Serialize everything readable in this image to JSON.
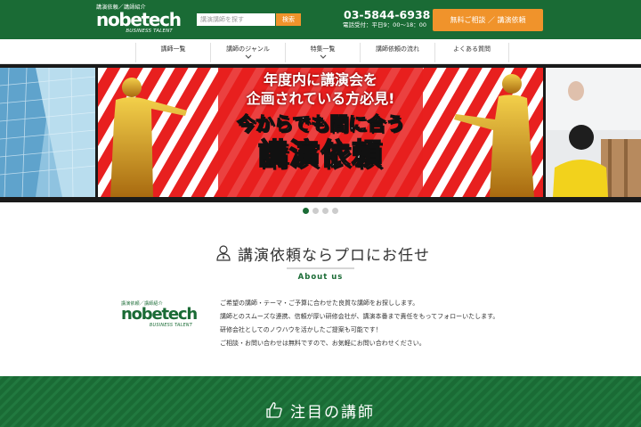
{
  "header": {
    "logo_tag": "講演依頼／講師紹介",
    "logo_main": "nobetech",
    "logo_sub": "BUSINESS TALENT",
    "search_placeholder": "講演講師を探す",
    "search_button": "検索",
    "phone": "03-5844-6938",
    "hours": "電話受付：平日9：00〜18：00",
    "cta_label": "無料ご相談 ／ 講演依頼",
    "colors": {
      "brand": "#1a6b35",
      "accent": "#f0932b"
    }
  },
  "nav": {
    "items": [
      {
        "label": "講師一覧",
        "has_caret": false
      },
      {
        "label": "講師のジャンル",
        "has_caret": true
      },
      {
        "label": "特集一覧",
        "has_caret": true
      },
      {
        "label": "講師依頼の流れ",
        "has_caret": false
      },
      {
        "label": "よくある質問",
        "has_caret": false
      }
    ]
  },
  "hero": {
    "line1": "年度内に講演会を",
    "line2": "企画されている方必見!",
    "line3": "今からでも間に合う",
    "line4": "講演依頼",
    "slides_count": 4,
    "active_slide": 1
  },
  "about": {
    "title": "講演依頼ならプロにお任せ",
    "subtitle": "About us",
    "logo_tag": "講演依頼／講師紹介",
    "logo_main": "nobetech",
    "logo_sub": "BUSINESS TALENT",
    "paragraphs": [
      "ご希望の講師・テーマ・ご予算に合わせた良質な講師をお探しします。",
      "講師とのスムーズな連携、信頼が厚い研修会社が、講演本番まで責任をもってフォローいたします。",
      "研修会社としてのノウハウを活かしたご提案も可能です！",
      "ご相談・お問い合わせは無料ですので、お気軽にお問い合わせください。"
    ]
  },
  "featured": {
    "title": "注目の講師"
  }
}
